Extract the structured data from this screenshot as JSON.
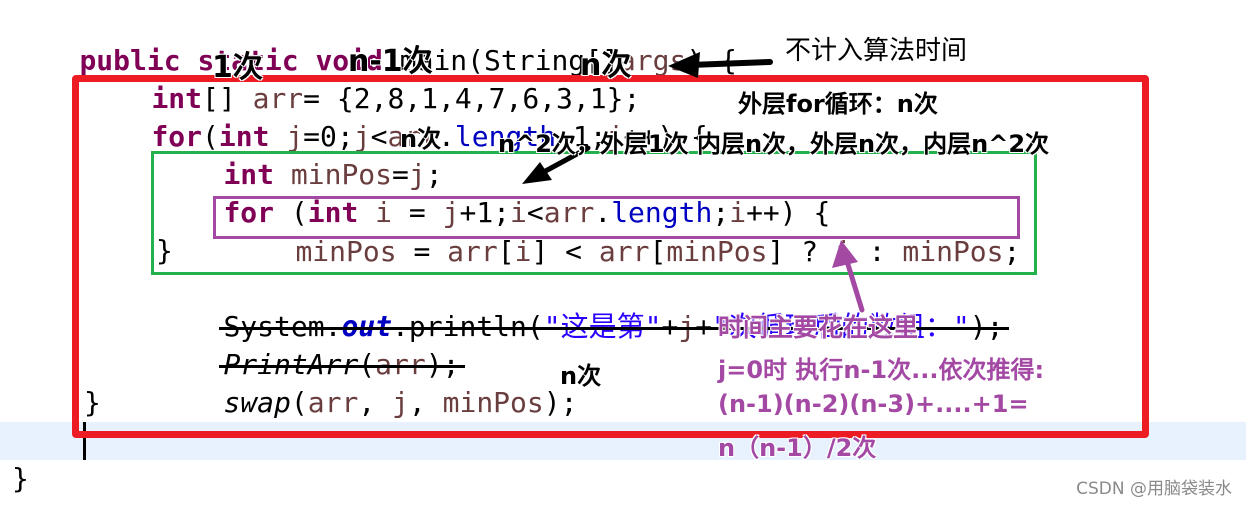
{
  "editor": {
    "lines": {
      "main_sig": {
        "kw": "public static void",
        "rest": " main(String[]",
        "args": "args",
        "end": ") {"
      },
      "arr_decl": {
        "kw": "int",
        "p1": "[] ",
        "var": "arr",
        "p2": "= {2,8,1,4,7,6,3,1};"
      },
      "outer_for": {
        "kw1": "for",
        "p1": "(",
        "kw2": "int",
        "p2": " ",
        "v1": "j",
        "p3": "=0;",
        "v2": "j",
        "p4": "<",
        "v3": "arr",
        "p5": ".",
        "field": "length",
        "p6": "-1;",
        "v4": "j",
        "p7": "++) {"
      },
      "minpos_decl": {
        "kw": "int",
        "p1": " ",
        "var": "minPos",
        "p2": "=",
        "v2": "j",
        "p3": ";"
      },
      "inner_for": {
        "kw1": "for",
        "p1": " (",
        "kw2": "int",
        "p2": " ",
        "v1": "i",
        "p3": " = ",
        "v2": "j",
        "p4": "+1;",
        "v3": "i",
        "p5": "<",
        "v4": "arr",
        "p6": ".",
        "field": "length",
        "p7": ";",
        "v5": "i",
        "p8": "++) {"
      },
      "ternary": {
        "v1": "minPos",
        "p1": " = ",
        "v2": "arr",
        "p2": "[",
        "v3": "i",
        "p3": "] < ",
        "v4": "arr",
        "p4": "[",
        "v5": "minPos",
        "p5": "] ? ",
        "v6": "i",
        "p6": " : ",
        "v7": "minPos",
        "p7": ";"
      },
      "inner_close": "}",
      "println": {
        "p1": "System.",
        "field": "out",
        "p2": ".println(",
        "s1": "\"这是第\"",
        "p3": "+",
        "v": "j",
        "p4": "+",
        "s2": "\"次循环后的数组：\"",
        "p5": ");"
      },
      "printarr": {
        "fn": "PrintArr",
        "p1": "(",
        "v": "arr",
        "p2": ");"
      },
      "swap": {
        "fn": "swap",
        "p1": "(",
        "v1": "arr",
        "p2": ", ",
        "v2": "j",
        "p3": ", ",
        "v3": "minPos",
        "p4": ");"
      },
      "outer_close": "}",
      "method_close": "}"
    }
  },
  "annotations": {
    "one_time": "1次",
    "n_minus_1": "n-1次",
    "n_times_top": "n次",
    "not_counted": "不计入算法时间",
    "outer_for_n": "外层for循环：n次",
    "minpos_n": "n次",
    "n_squared": "n^2次，外层1次 内层n次，外层n次，内层n^2次",
    "swap_n": "n次",
    "main_cost_1": "时间主要花在这里",
    "main_cost_2": "j=0时 执行n-1次...依次推得:",
    "main_cost_3": "(n-1)(n-2)(n-3)+....+1=",
    "main_cost_4": "n（n-1）/2次"
  },
  "watermark": "CSDN @用脑袋装水",
  "colors": {
    "red_box": "#ed1c24",
    "green_box": "#22b14c",
    "purple_box": "#a349a4",
    "keyword": "#7f0055",
    "variable": "#6a3e3e",
    "field": "#0000c0",
    "string": "#2a00ff",
    "current_line": "#e8f2fe"
  }
}
